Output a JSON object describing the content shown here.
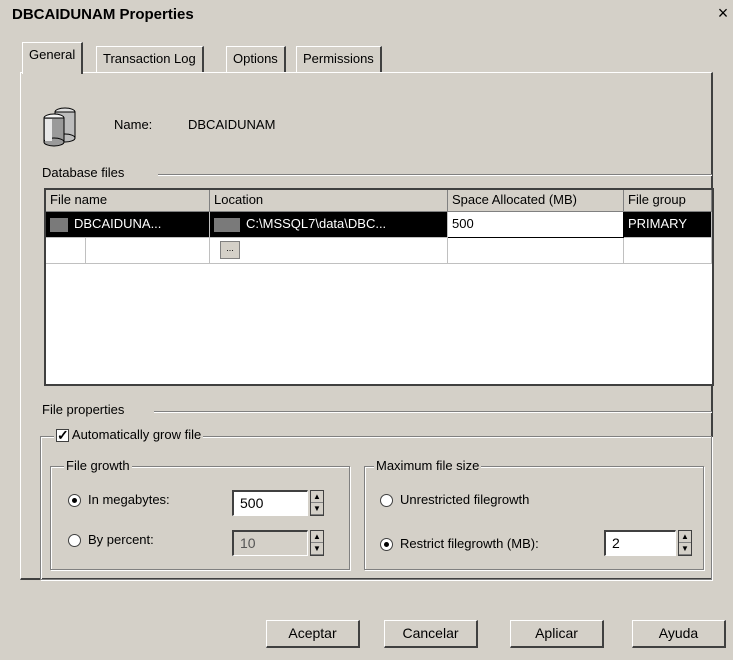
{
  "window": {
    "title": "DBCAIDUNAM Properties",
    "close_glyph": "×"
  },
  "tabs": [
    {
      "label": "General",
      "active": true
    },
    {
      "label": "Transaction Log",
      "active": false
    },
    {
      "label": "Options",
      "active": false
    },
    {
      "label": "Permissions",
      "active": false
    }
  ],
  "general": {
    "name_label": "Name:",
    "name_value": "DBCAIDUNAM",
    "db_icon": "database-icon"
  },
  "database_files": {
    "section_label": "Database files",
    "columns": [
      "File name",
      "Location",
      "Space Allocated (MB)",
      "File group"
    ],
    "rows": [
      {
        "file_name": "DBCAIDUNA...",
        "location": "C:\\MSSQL7\\data\\DBC...",
        "space": "500",
        "file_group": "PRIMARY",
        "selected": true
      }
    ],
    "browse_glyph": "..."
  },
  "file_properties": {
    "section_label": "File properties",
    "auto_grow_label": "Automatically grow file",
    "auto_grow_checked": true,
    "check_glyph": "✓",
    "file_growth": {
      "label": "File growth",
      "in_megabytes_label": "In megabytes:",
      "in_megabytes_value": "500",
      "by_percent_label": "By percent:",
      "by_percent_value": "10",
      "selected": "megabytes"
    },
    "max_size": {
      "label": "Maximum file size",
      "unrestricted_label": "Unrestricted filegrowth",
      "restrict_label": "Restrict filegrowth (MB):",
      "restrict_value": "2",
      "selected": "restrict"
    }
  },
  "buttons": {
    "ok": "Aceptar",
    "cancel": "Cancelar",
    "apply": "Aplicar",
    "help": "Ayuda"
  },
  "spin_glyphs": {
    "up": "▲",
    "down": "▼"
  }
}
